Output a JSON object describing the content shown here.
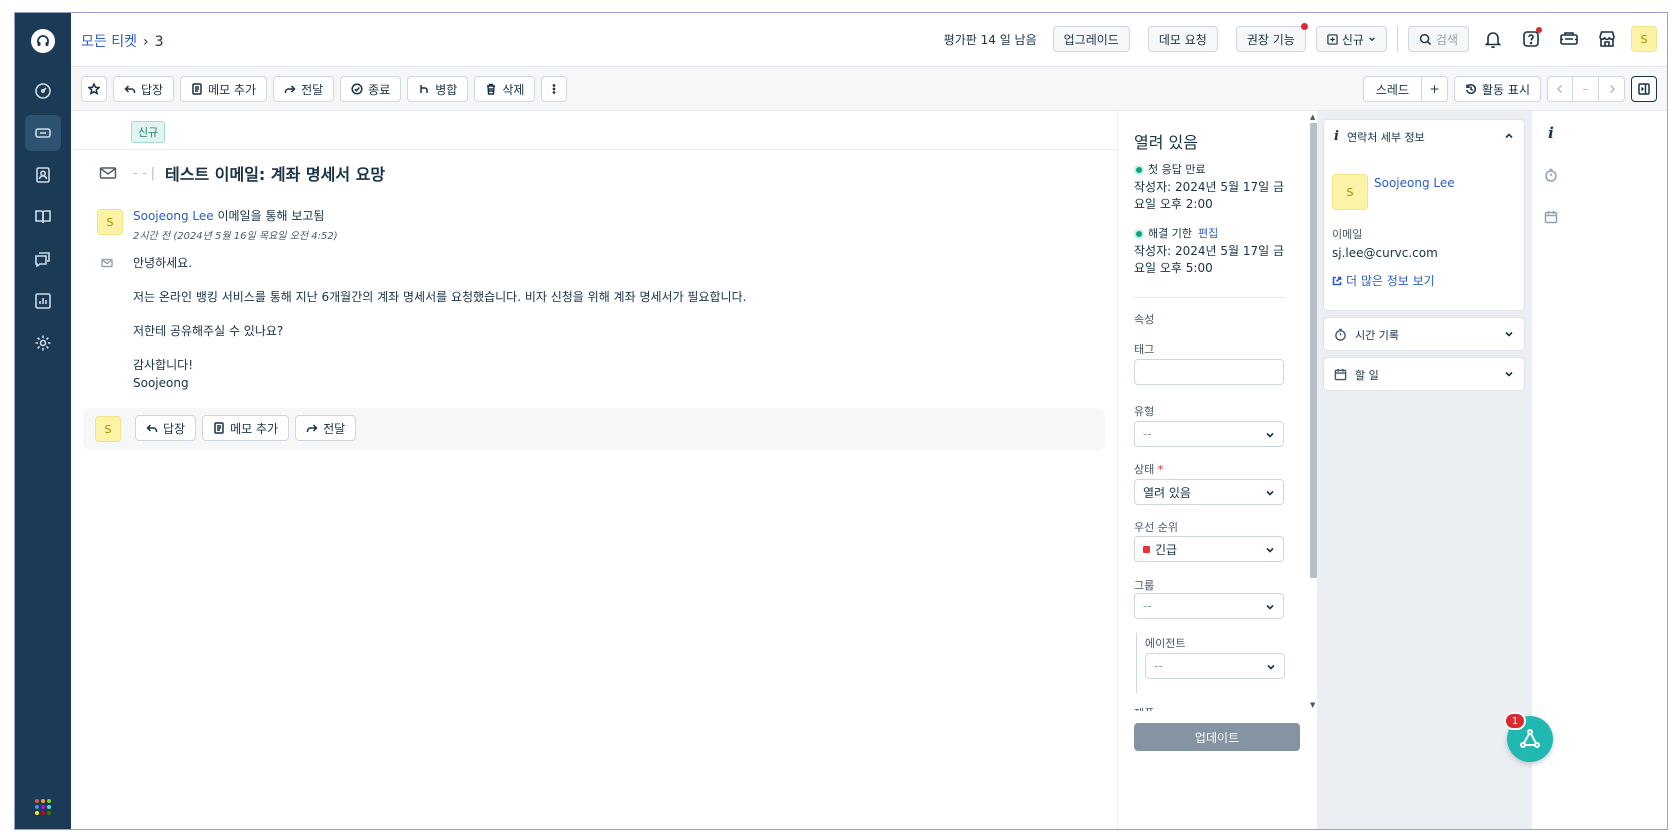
{
  "header": {
    "breadcrumb_link": "모든 티켓",
    "breadcrumb_current": "3",
    "trial_text": "평가판 14 일 남음",
    "upgrade_label": "업그레이드",
    "demo_label": "데모 요청",
    "recommended_label": "권장 기능",
    "new_label": "신규",
    "search_label": "검색",
    "avatar_initial": "S"
  },
  "toolbar": {
    "reply_label": "답장",
    "add_note_label": "메모 추가",
    "forward_label": "전달",
    "close_label": "종료",
    "merge_label": "병합",
    "delete_label": "삭제",
    "thread_label": "스레드",
    "plus_label": "+",
    "activity_label": "활동 표시",
    "dash_label": "–"
  },
  "ticket": {
    "tag": "신규",
    "subject_prefix": "- - |",
    "subject": "테스트 이메일: 계좌 명세서 요망",
    "sender_initial": "S",
    "sender_name": "Soojeong Lee",
    "sender_via": "이메일을 통해 보고됨",
    "timestamp": "2시간 전 (2024년 5월 16일 목요일 오전 4:52)",
    "body": {
      "greeting": "안녕하세요.",
      "line1": "저는 온라인 뱅킹 서비스를 통해 지난 6개월간의 계좌 명세서를 요청했습니다. 비자 신청을 위해 계좌 명세서가 필요합니다.",
      "line2": "저한테 공유해주실 수 있나요?",
      "closing": "감사합니다!",
      "signature": "Soojeong"
    },
    "reply_bar": {
      "avatar_initial": "S",
      "reply_label": "답장",
      "add_note_label": "메모 추가",
      "forward_label": "전달"
    }
  },
  "properties": {
    "status_title": "열려 있음",
    "first_response_label": "첫 응답 만료",
    "first_response_time": "작성자: 2024년 5월 17일 금요일 오후 2:00",
    "resolution_label": "해결 기한",
    "resolution_edit": "편집",
    "resolution_time": "작성자: 2024년 5월 17일 금요일 오후 5:00",
    "section_label": "속성",
    "tags_label": "태그",
    "type_label": "유형",
    "type_value": "--",
    "status_label": "상태",
    "status_required": "*",
    "status_value": "열려 있음",
    "priority_label": "우선 순위",
    "priority_value": "긴급",
    "group_label": "그룹",
    "group_value": "--",
    "agent_label": "에이전트",
    "agent_value": "--",
    "cut_label": "제품",
    "update_label": "업데이트",
    "colors": {
      "sla_green": "#00a886",
      "urgent_red": "#e43538"
    }
  },
  "contact": {
    "card_title": "연락처 세부 정보",
    "avatar_initial": "S",
    "name": "Soojeong Lee",
    "email_label": "이메일",
    "email": "sj.lee@curvc.com",
    "more_link": "더 많은 정보 보기",
    "time_log_title": "시간 기록",
    "todo_title": "할 일"
  },
  "launcher": {
    "badge": "1"
  }
}
